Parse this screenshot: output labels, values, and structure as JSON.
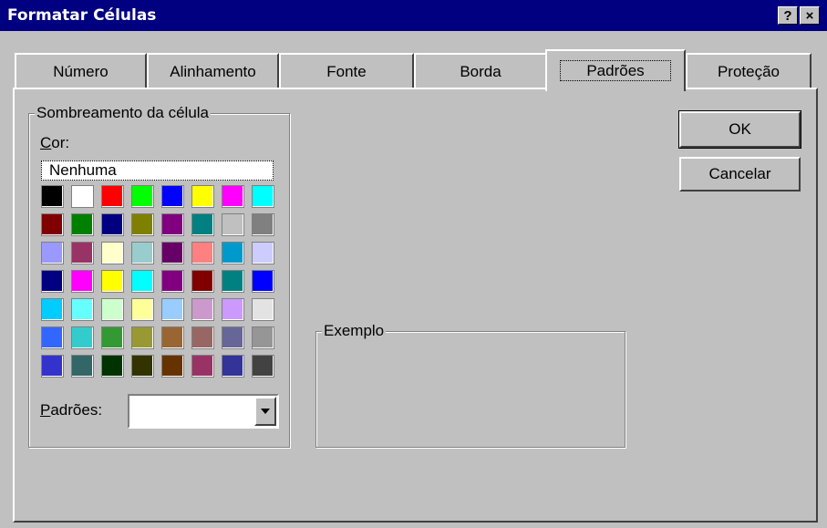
{
  "window": {
    "title": "Formatar Células",
    "help_button": "?",
    "close_button": "×"
  },
  "tabs": [
    {
      "label": "Número"
    },
    {
      "label": "Alinhamento"
    },
    {
      "label": "Fonte"
    },
    {
      "label": "Borda"
    },
    {
      "label": "Padrões",
      "selected": true
    },
    {
      "label": "Proteção"
    }
  ],
  "shading": {
    "group_label": "Sombreamento da célula",
    "color_label_first": "C",
    "color_label_rest": "or:",
    "none_option": "Nenhuma",
    "palette": [
      [
        "#000000",
        "#ffffff",
        "#ff0000",
        "#00ff00",
        "#0000ff",
        "#ffff00",
        "#ff00ff",
        "#00ffff"
      ],
      [
        "#800000",
        "#008000",
        "#000080",
        "#808000",
        "#800080",
        "#008080",
        "#c0c0c0",
        "#808080"
      ],
      [
        "#9999ff",
        "#993366",
        "#ffffcc",
        "#99cccc",
        "#660066",
        "#ff8080",
        "#0099cc",
        "#ccccff"
      ],
      [
        "#000080",
        "#ff00ff",
        "#ffff00",
        "#00ffff",
        "#800080",
        "#800000",
        "#008080",
        "#0000ff"
      ],
      [
        "#00ccff",
        "#66ffff",
        "#ccffcc",
        "#ffff99",
        "#99ccff",
        "#cc99cc",
        "#cc99ff",
        "#e3e3e3"
      ],
      [
        "#3366ff",
        "#33cccc",
        "#339933",
        "#999933",
        "#996633",
        "#996666",
        "#666699",
        "#969696"
      ],
      [
        "#3333cc",
        "#336666",
        "#003300",
        "#333300",
        "#663300",
        "#993366",
        "#333399",
        "#424242"
      ]
    ],
    "patterns_label_first": "P",
    "patterns_label_rest": "adrões:",
    "patterns_value": ""
  },
  "example": {
    "group_label": "Exemplo"
  },
  "buttons": {
    "ok": "OK",
    "cancel": "Cancelar"
  }
}
